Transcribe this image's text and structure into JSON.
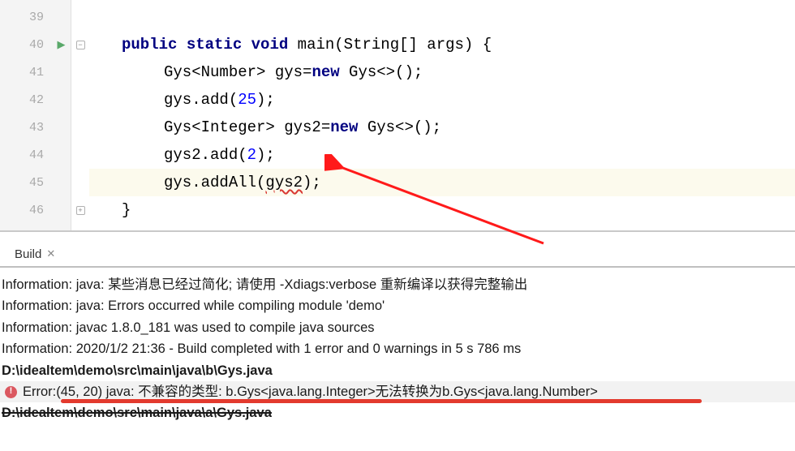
{
  "editor": {
    "lines": [
      {
        "n": "39",
        "indent": 0,
        "runnable": false,
        "fold": "",
        "caret": false,
        "tokens": []
      },
      {
        "n": "40",
        "indent": 1,
        "runnable": true,
        "fold": "open",
        "caret": false,
        "tokens": [
          {
            "t": "public ",
            "c": "kw"
          },
          {
            "t": "static ",
            "c": "kw"
          },
          {
            "t": "void ",
            "c": "kw"
          },
          {
            "t": "main(String[] args) {",
            "c": "plain"
          }
        ]
      },
      {
        "n": "41",
        "indent": 2,
        "runnable": false,
        "fold": "",
        "caret": false,
        "tokens": [
          {
            "t": "Gys<Number> gys=",
            "c": "plain"
          },
          {
            "t": "new ",
            "c": "kw"
          },
          {
            "t": "Gys<>();",
            "c": "plain"
          }
        ]
      },
      {
        "n": "42",
        "indent": 2,
        "runnable": false,
        "fold": "",
        "caret": false,
        "tokens": [
          {
            "t": "gys.add(",
            "c": "plain"
          },
          {
            "t": "25",
            "c": "num"
          },
          {
            "t": ");",
            "c": "plain"
          }
        ]
      },
      {
        "n": "43",
        "indent": 2,
        "runnable": false,
        "fold": "",
        "caret": false,
        "tokens": [
          {
            "t": "Gys<Integer> gys2=",
            "c": "plain"
          },
          {
            "t": "new ",
            "c": "kw"
          },
          {
            "t": "Gys<>();",
            "c": "plain"
          }
        ]
      },
      {
        "n": "44",
        "indent": 2,
        "runnable": false,
        "fold": "",
        "caret": false,
        "tokens": [
          {
            "t": "gys2.add(",
            "c": "plain"
          },
          {
            "t": "2",
            "c": "num"
          },
          {
            "t": ");",
            "c": "plain"
          }
        ]
      },
      {
        "n": "45",
        "indent": 2,
        "runnable": false,
        "fold": "",
        "caret": true,
        "tokens": [
          {
            "t": "gys.addAll(",
            "c": "plain"
          },
          {
            "t": "gys2",
            "c": "squiggly"
          },
          {
            "t": ");",
            "c": "plain"
          }
        ]
      },
      {
        "n": "46",
        "indent": 1,
        "runnable": false,
        "fold": "close",
        "caret": false,
        "tokens": [
          {
            "t": "}",
            "c": "plain"
          }
        ]
      }
    ]
  },
  "build": {
    "tab_label": "Build",
    "messages": [
      {
        "kind": "info",
        "text": "Information: java: 某些消息已经过简化; 请使用 -Xdiags:verbose 重新编译以获得完整输出"
      },
      {
        "kind": "info",
        "text": "Information: java: Errors occurred while compiling module 'demo'"
      },
      {
        "kind": "info",
        "text": "Information: javac 1.8.0_181 was used to compile java sources"
      },
      {
        "kind": "info",
        "text": "Information: 2020/1/2 21:36 - Build completed with 1 error and 0 warnings in 5 s 786 ms"
      },
      {
        "kind": "file",
        "text": "D:\\idealtem\\demo\\src\\main\\java\\b\\Gys.java"
      },
      {
        "kind": "error",
        "text": "Error:(45, 20)  java: 不兼容的类型: b.Gys<java.lang.Integer>无法转换为b.Gys<java.lang.Number>"
      },
      {
        "kind": "file-strike",
        "text": "D:\\idealtem\\demo\\src\\main\\java\\a\\Gys.java"
      }
    ]
  }
}
